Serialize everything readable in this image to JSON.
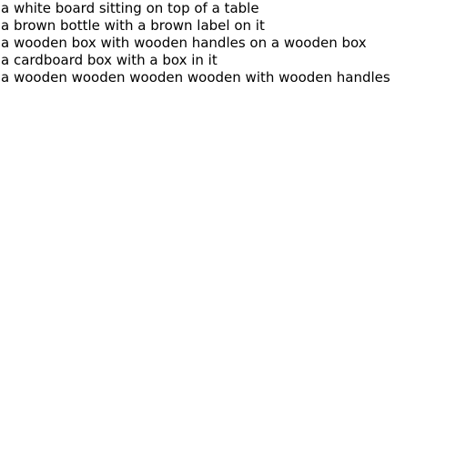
{
  "captions": [
    "a white board sitting on top of a table",
    "a brown bottle with a brown label on it",
    "a wooden box with wooden handles on a wooden box",
    "a cardboard box with a box in it",
    "a wooden wooden wooden wooden with wooden handles"
  ],
  "colors": {
    "background": "#ffffff",
    "text": "#000000"
  }
}
